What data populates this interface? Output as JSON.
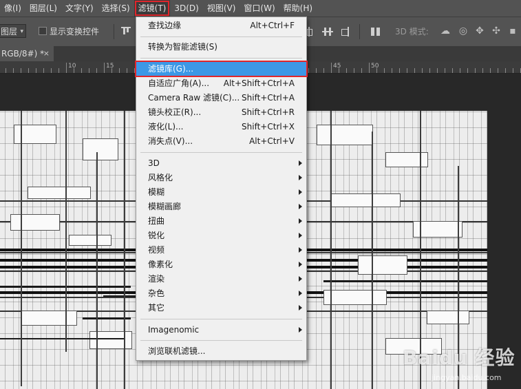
{
  "menubar": {
    "items": [
      {
        "label": "像(I)"
      },
      {
        "label": "图层(L)"
      },
      {
        "label": "文字(Y)"
      },
      {
        "label": "选择(S)"
      },
      {
        "label": "滤镜(T)"
      },
      {
        "label": "3D(D)"
      },
      {
        "label": "视图(V)"
      },
      {
        "label": "窗口(W)"
      },
      {
        "label": "帮助(H)"
      }
    ]
  },
  "options_bar": {
    "layer_select_value": "图层",
    "show_transform_controls_label": "显示变换控件",
    "mode_3d_label": "3D 模式:"
  },
  "document_tab": {
    "title": "RGB/8#) *",
    "close": "×"
  },
  "ruler": {
    "labels": [
      "10",
      "15",
      "20",
      "25",
      "30",
      "35",
      "40",
      "45",
      "50"
    ]
  },
  "filter_menu": {
    "items": [
      {
        "label": "查找边缘",
        "shortcut": "Alt+Ctrl+F"
      },
      {
        "label": "转换为智能滤镜(S)",
        "shortcut": ""
      },
      {
        "label": "滤镜库(G)...",
        "shortcut": ""
      },
      {
        "label": "自适应广角(A)...",
        "shortcut": "Alt+Shift+Ctrl+A"
      },
      {
        "label": "Camera Raw 滤镜(C)...",
        "shortcut": "Shift+Ctrl+A"
      },
      {
        "label": "镜头校正(R)...",
        "shortcut": "Shift+Ctrl+R"
      },
      {
        "label": "液化(L)...",
        "shortcut": "Shift+Ctrl+X"
      },
      {
        "label": "消失点(V)...",
        "shortcut": "Alt+Ctrl+V"
      },
      {
        "label": "3D",
        "shortcut": ""
      },
      {
        "label": "风格化",
        "shortcut": ""
      },
      {
        "label": "模糊",
        "shortcut": ""
      },
      {
        "label": "模糊画廊",
        "shortcut": ""
      },
      {
        "label": "扭曲",
        "shortcut": ""
      },
      {
        "label": "锐化",
        "shortcut": ""
      },
      {
        "label": "视频",
        "shortcut": ""
      },
      {
        "label": "像素化",
        "shortcut": ""
      },
      {
        "label": "渲染",
        "shortcut": ""
      },
      {
        "label": "杂色",
        "shortcut": ""
      },
      {
        "label": "其它",
        "shortcut": ""
      },
      {
        "label": "Imagenomic",
        "shortcut": ""
      },
      {
        "label": "浏览联机滤镜...",
        "shortcut": ""
      }
    ]
  },
  "watermark": {
    "brand": "Baidu 经验",
    "url": "jingyan.baidu.com"
  },
  "colors": {
    "highlight": "#3c98e6",
    "annotation_red": "#e0262b",
    "menu_bg": "#f0f0f0",
    "app_bg": "#535353"
  }
}
